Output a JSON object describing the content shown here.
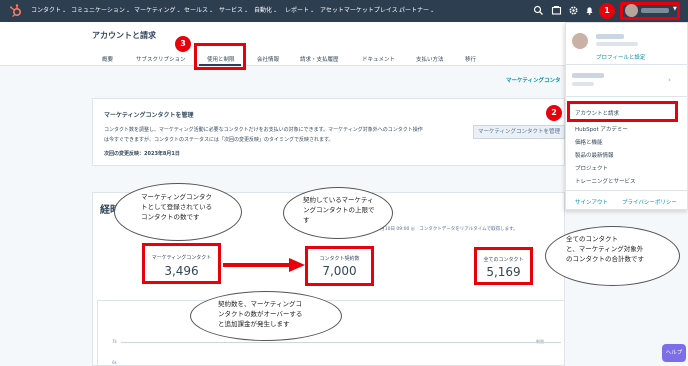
{
  "nav": {
    "items": [
      "コンタクト",
      "コミュニケーション",
      "マーケティング",
      "セールス",
      "サービス",
      "自動化",
      "レポート",
      "アセットマーケットプレイス",
      "パートナー"
    ]
  },
  "header": {
    "title": "アカウントと請求",
    "tabs": [
      "概要",
      "サブスクリプション",
      "使用と制限",
      "会社情報",
      "請求・支払履歴",
      "ドキュメント",
      "支払い方法",
      "移行"
    ]
  },
  "marketing_link": "マーケティングコンタ",
  "manage_card": {
    "title": "マーケティングコンタクトを管理",
    "line1": "コンタクト数を調整し、マーケティング活動に必要なコンタクトだけをお支払いの対象にできます。マーケティング対象外へのコンタクト操作",
    "line2": "は今すぐできますが、コンタクトのステータスには「次回の変更反映」のタイミングで反映されます。",
    "next_change": "次回の変更反映：2023年8月1日",
    "button": "マーケティングコンタクトを管理"
  },
  "section_title": "経時",
  "sync_note": "4年7月10日 09:00 ◎　コンタクトデータをリアルタイムで取得します。",
  "stats": [
    {
      "label": "マーケティングコンタクト",
      "value": "3,496"
    },
    {
      "label": "コンタクト契約数",
      "value": "7,000"
    },
    {
      "label": "全てのコンタクト",
      "value": "5,169"
    }
  ],
  "chart": {
    "y_tick_top": "7k",
    "y_tick_mid": "6k",
    "right_label": "制限"
  },
  "dropdown": {
    "profile_link": "プロフィールと設定",
    "account_billing": "アカウントと請求",
    "academy": "HubSpot アカデミー",
    "pricing": "価格と機能",
    "updates": "製品の最新情報",
    "projects": "プロジェクト",
    "training": "トレーニングとサービス",
    "signout": "サインアウト",
    "privacy": "プライバシーポリシー"
  },
  "callouts": {
    "c1": [
      "マーケティングコンタク",
      "トとして登録されている",
      "コンタクトの数です"
    ],
    "c2": [
      "契約しているマーケティ",
      "ングコンタクトの上限で",
      "す"
    ],
    "c3": [
      "契約数を、マーケティングコ",
      "ンタクトの数がオーバーする",
      "と追加課金が発生します"
    ],
    "c4": [
      "全てのコンタクト",
      "と、マーケティング対象外",
      "のコンタクトの合計数です"
    ]
  },
  "badges": [
    "1",
    "2",
    "3"
  ],
  "help": "ヘルプ",
  "colors": {
    "nav_bg": "#2d3e50",
    "highlight": "#e8000b",
    "link": "#0091ae"
  }
}
